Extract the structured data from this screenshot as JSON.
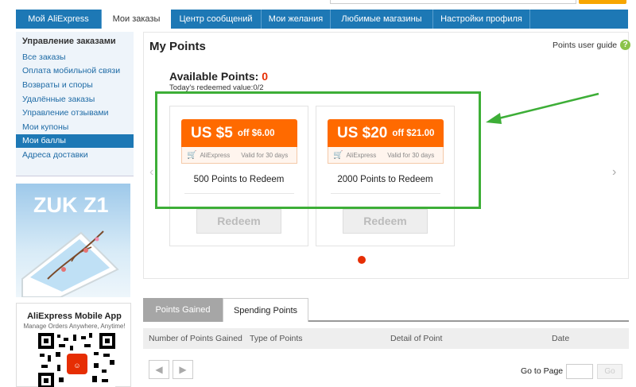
{
  "nav": {
    "items": [
      {
        "label": "Мой AliExpress"
      },
      {
        "label": "Мои заказы"
      },
      {
        "label": "Центр сообщений"
      },
      {
        "label": "Мои желания"
      },
      {
        "label": "Любимые магазины"
      },
      {
        "label": "Настройки профиля"
      }
    ]
  },
  "sidebar": {
    "title": "Управление заказами",
    "items": [
      {
        "label": "Все заказы"
      },
      {
        "label": "Оплата мобильной связи"
      },
      {
        "label": "Возвраты и споры"
      },
      {
        "label": "Удалённые заказы"
      },
      {
        "label": "Управление отзывами"
      },
      {
        "label": "Мои купоны"
      },
      {
        "label": "Мои баллы"
      },
      {
        "label": "Адреса доставки"
      }
    ]
  },
  "banner": {
    "title": "ZUK Z1"
  },
  "app": {
    "title": "AliExpress Mobile App",
    "subtitle": "Manage Orders Anywhere, Anytime!"
  },
  "main": {
    "title": "My Points",
    "guide_label": "Points user guide",
    "available_label": "Available Points:",
    "available_value": "0",
    "today_text": "Today's redeemed value:0/2"
  },
  "cards": [
    {
      "amount": "US $5",
      "off": "off $6.00",
      "brand": "AliExpress",
      "valid": "Valid for 30 days",
      "points": "500 Points to Redeem",
      "button": "Redeem"
    },
    {
      "amount": "US $20",
      "off": "off $21.00",
      "brand": "AliExpress",
      "valid": "Valid for 30 days",
      "points": "2000 Points to Redeem",
      "button": "Redeem"
    }
  ],
  "tabs": [
    {
      "label": "Points Gained"
    },
    {
      "label": "Spending Points"
    }
  ],
  "table": {
    "headers": [
      "Number of Points Gained",
      "Type of Points",
      "Detail of Point",
      "Date"
    ]
  },
  "pagination": {
    "prev": "◀",
    "next": "▶",
    "goto_label": "Go to Page",
    "goto_button": "Go"
  },
  "colors": {
    "nav": "#1d78b5",
    "coupon": "#ff6a00",
    "highlight": "#3dae37",
    "points_value": "#e62e04"
  }
}
